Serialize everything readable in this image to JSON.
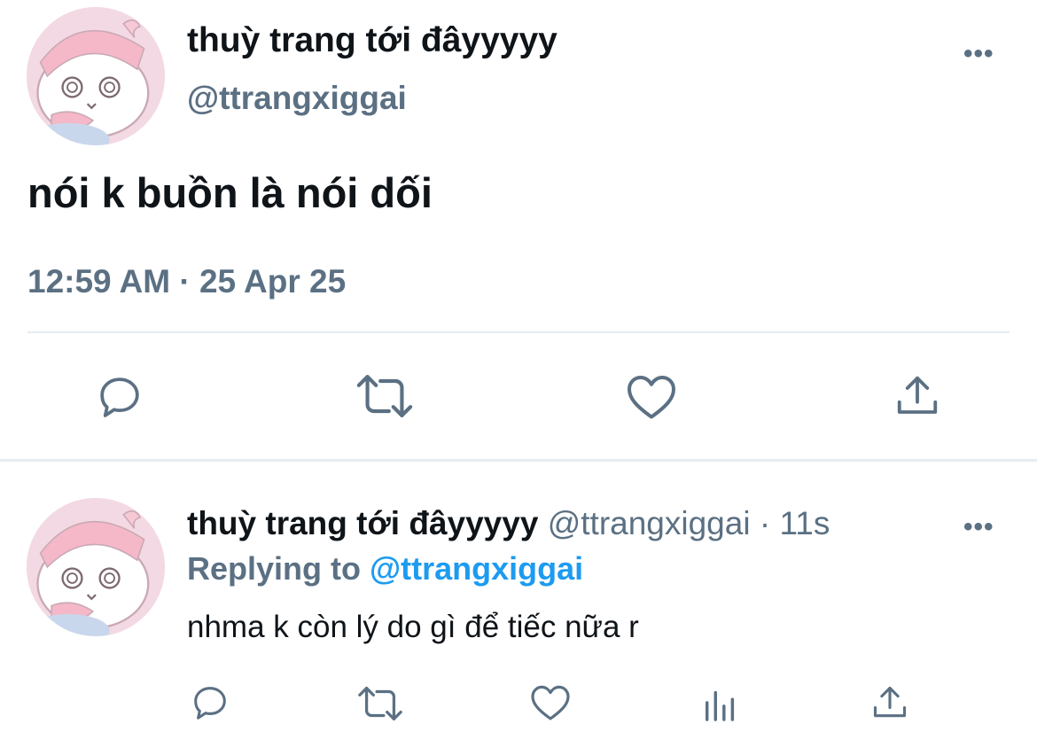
{
  "main_tweet": {
    "display_name": "thuỳ trang tới đâyyyyy",
    "handle": "@ttrangxiggai",
    "text": "nói k buồn là nói dối",
    "time": "12:59 AM",
    "separator": "·",
    "date": "25 Apr 25",
    "more": "•••",
    "actions": [
      "reply-icon",
      "retweet-icon",
      "like-icon",
      "share-icon"
    ]
  },
  "reply_tweet": {
    "display_name": "thuỳ trang tới đâyyyyy",
    "handle": "@ttrangxiggai",
    "separator": "·",
    "time": "11s",
    "more": "•••",
    "replying_prefix": "Replying to",
    "replying_mention": "@ttrangxiggai",
    "text": "nhma k còn lý do gì để tiếc nữa r",
    "actions": [
      "reply-icon",
      "retweet-icon",
      "like-icon",
      "analytics-icon",
      "share-icon"
    ]
  },
  "colors": {
    "text_primary": "#0f1419",
    "text_secondary": "#5b7083",
    "link": "#1d9bf0",
    "divider": "#e6ecf0",
    "avatar_bg": "#f3d9e3"
  }
}
